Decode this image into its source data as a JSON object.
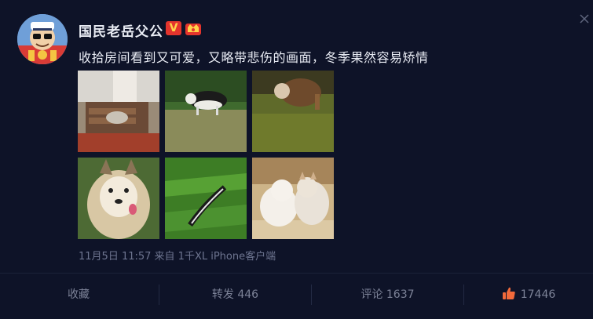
{
  "post": {
    "username": "国民老岳父公",
    "verified_badge": "V",
    "text": "收拾房间看到又可爱，又略带悲伤的画面，冬季果然容易矫情",
    "meta": "11月5日 11:57 来自 1千XL iPhone客户端"
  },
  "images": [
    {
      "name": "photo-room-floor",
      "icon": "photo"
    },
    {
      "name": "photo-husky-walking",
      "icon": "photo"
    },
    {
      "name": "photo-dog-in-yard",
      "icon": "photo"
    },
    {
      "name": "photo-malamute-face",
      "icon": "photo"
    },
    {
      "name": "photo-grass-feather",
      "icon": "photo"
    },
    {
      "name": "photo-two-cats",
      "icon": "photo"
    }
  ],
  "actions": {
    "favorite": "收藏",
    "repost": "转发 446",
    "comment": "评论 1637",
    "like_count": "17446"
  },
  "colors": {
    "background": "#0e1328",
    "text": "#e9ecf4",
    "muted": "#6e7590",
    "verified_red": "#e4342d",
    "like_orange": "#f26a3b"
  }
}
